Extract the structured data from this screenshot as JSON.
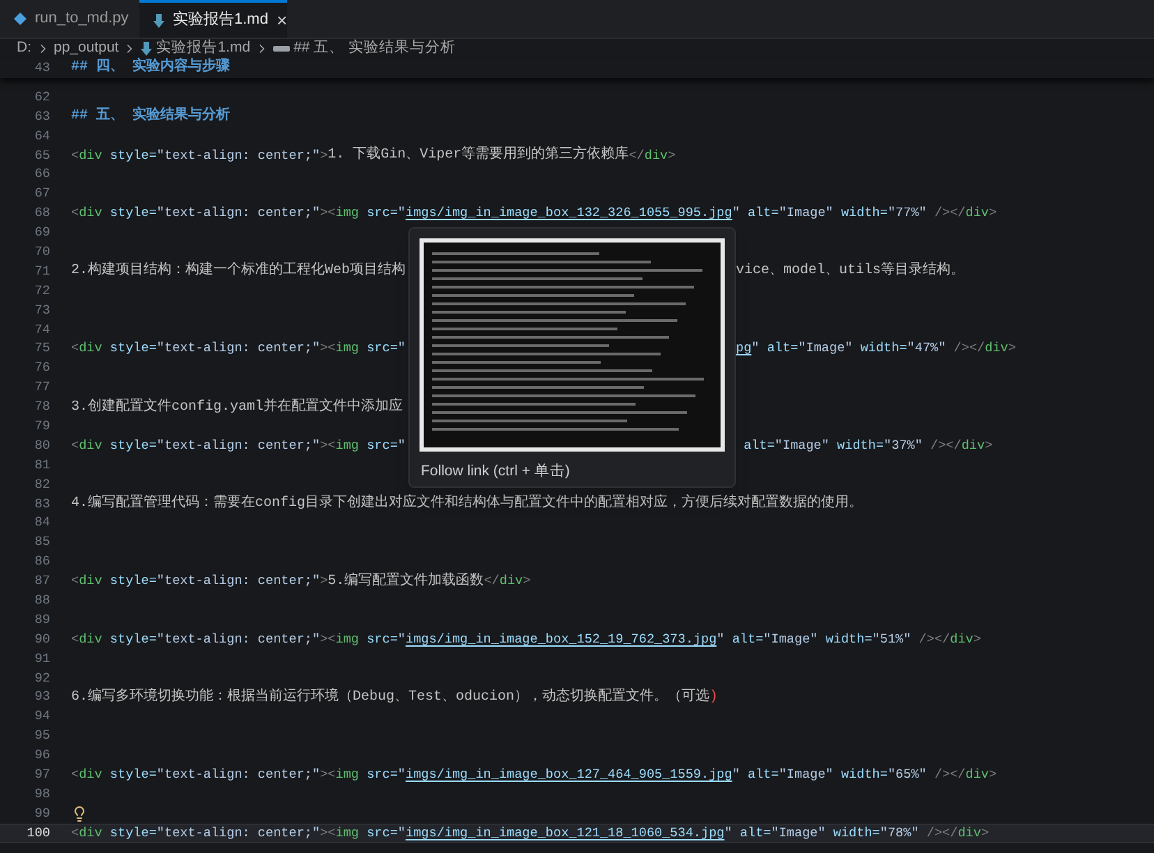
{
  "tabs": [
    {
      "label": "run_to_md.py",
      "kind": "python",
      "selected": false
    },
    {
      "label": "实验报告1.md",
      "kind": "markdown",
      "selected": true
    }
  ],
  "close_glyph": "×",
  "breadcrumb": [
    {
      "label": "D:",
      "kind": "folder"
    },
    {
      "label": "pp_output",
      "kind": "folder"
    },
    {
      "label": "实验报告1.md",
      "kind": "markdown"
    },
    {
      "label": "## 五、 实验结果与分析",
      "kind": "symbol"
    }
  ],
  "sticky_line": {
    "number": "43",
    "tokens": [
      {
        "kind": "heading",
        "text": "## 四、 实验内容与步骤"
      }
    ]
  },
  "lines": [
    {
      "number": "62",
      "current": false,
      "lightbulb": false
    },
    {
      "number": "63",
      "current": false,
      "lightbulb": false,
      "tokens": [
        {
          "kind": "heading",
          "text": "## 五、 实验结果与分析"
        }
      ]
    },
    {
      "number": "64",
      "current": false,
      "lightbulb": false
    },
    {
      "number": "65",
      "current": false,
      "lightbulb": false,
      "tokens": [
        {
          "kind": "punct",
          "text": "<"
        },
        {
          "kind": "tag",
          "text": "div"
        },
        {
          "kind": "attr",
          "text": " style="
        },
        {
          "kind": "str",
          "text": "\"text-align: center;\""
        },
        {
          "kind": "punct",
          "text": ">"
        },
        {
          "kind": "text",
          "text": "1. 下载Gin、Viper等需要用到的第三方依赖库"
        },
        {
          "kind": "punct",
          "text": "</"
        },
        {
          "kind": "tag",
          "text": "div"
        },
        {
          "kind": "punct",
          "text": ">"
        }
      ]
    },
    {
      "number": "66",
      "current": false,
      "lightbulb": false
    },
    {
      "number": "67",
      "current": false,
      "lightbulb": false
    },
    {
      "number": "68",
      "current": false,
      "lightbulb": false,
      "tokens": [
        {
          "kind": "punct",
          "text": "<"
        },
        {
          "kind": "tag",
          "text": "div"
        },
        {
          "kind": "attr",
          "text": " style="
        },
        {
          "kind": "str",
          "text": "\"text-align: center;\""
        },
        {
          "kind": "punct",
          "text": "><"
        },
        {
          "kind": "tag",
          "text": "img"
        },
        {
          "kind": "attr",
          "text": " src="
        },
        {
          "kind": "str",
          "text": "\""
        },
        {
          "kind": "link",
          "text": "imgs/img_in_image_box_132_326_1055_995.jpg"
        },
        {
          "kind": "str",
          "text": "\""
        },
        {
          "kind": "attr",
          "text": " alt="
        },
        {
          "kind": "str",
          "text": "\"Image\""
        },
        {
          "kind": "attr",
          "text": " width="
        },
        {
          "kind": "str",
          "text": "\"77%\""
        },
        {
          "kind": "punct",
          "text": " /></"
        },
        {
          "kind": "tag",
          "text": "div"
        },
        {
          "kind": "punct",
          "text": ">"
        }
      ]
    },
    {
      "number": "69",
      "current": false,
      "lightbulb": false
    },
    {
      "number": "70",
      "current": false,
      "lightbulb": false
    },
    {
      "number": "71",
      "current": false,
      "lightbulb": false,
      "tokens": [
        {
          "kind": "text",
          "text": "2.构建项目结构：构建一个标准的工程化Web项目结构"
        }
      ],
      "tokens_after": [
        {
          "kind": "text",
          "text": "vice、model、utils等目录结构。"
        }
      ]
    },
    {
      "number": "72",
      "current": false,
      "lightbulb": false
    },
    {
      "number": "73",
      "current": false,
      "lightbulb": false
    },
    {
      "number": "74",
      "current": false,
      "lightbulb": false
    },
    {
      "number": "75",
      "current": false,
      "lightbulb": false,
      "tokens": [
        {
          "kind": "punct",
          "text": "<"
        },
        {
          "kind": "tag",
          "text": "div"
        },
        {
          "kind": "attr",
          "text": " style="
        },
        {
          "kind": "str",
          "text": "\"text-align: center;\""
        },
        {
          "kind": "punct",
          "text": "><"
        },
        {
          "kind": "tag",
          "text": "img"
        },
        {
          "kind": "attr",
          "text": " src="
        },
        {
          "kind": "str",
          "text": "\""
        }
      ],
      "tokens_after": [
        {
          "kind": "link",
          "text": "pg"
        },
        {
          "kind": "str",
          "text": "\""
        },
        {
          "kind": "attr",
          "text": " alt="
        },
        {
          "kind": "str",
          "text": "\"Image\""
        },
        {
          "kind": "attr",
          "text": " width="
        },
        {
          "kind": "str",
          "text": "\"47%\""
        },
        {
          "kind": "punct",
          "text": " /></"
        },
        {
          "kind": "tag",
          "text": "div"
        },
        {
          "kind": "punct",
          "text": ">"
        }
      ]
    },
    {
      "number": "76",
      "current": false,
      "lightbulb": false
    },
    {
      "number": "77",
      "current": false,
      "lightbulb": false
    },
    {
      "number": "78",
      "current": false,
      "lightbulb": false,
      "tokens": [
        {
          "kind": "text",
          "text": "3.创建配置文件config.yaml并在配置文件中添加应"
        }
      ]
    },
    {
      "number": "79",
      "current": false,
      "lightbulb": false
    },
    {
      "number": "80",
      "current": false,
      "lightbulb": false,
      "tokens": [
        {
          "kind": "punct",
          "text": "<"
        },
        {
          "kind": "tag",
          "text": "div"
        },
        {
          "kind": "attr",
          "text": " style="
        },
        {
          "kind": "str",
          "text": "\"text-align: center;\""
        },
        {
          "kind": "punct",
          "text": "><"
        },
        {
          "kind": "tag",
          "text": "img"
        },
        {
          "kind": "attr",
          "text": " src="
        },
        {
          "kind": "str",
          "text": "\""
        }
      ],
      "tokens_after": [
        {
          "kind": "attr",
          "text": " alt="
        },
        {
          "kind": "str",
          "text": "\"Image\""
        },
        {
          "kind": "attr",
          "text": " width="
        },
        {
          "kind": "str",
          "text": "\"37%\""
        },
        {
          "kind": "punct",
          "text": " /></"
        },
        {
          "kind": "tag",
          "text": "div"
        },
        {
          "kind": "punct",
          "text": ">"
        }
      ]
    },
    {
      "number": "81",
      "current": false,
      "lightbulb": false
    },
    {
      "number": "82",
      "current": false,
      "lightbulb": false
    },
    {
      "number": "83",
      "current": false,
      "lightbulb": false,
      "tokens": [
        {
          "kind": "text",
          "text": "4.编写配置管理代码：需要在config目录下创建出对应文件和结构体与配置文件中的配置相对应，方便后续对配置数据的使用。"
        }
      ]
    },
    {
      "number": "84",
      "current": false,
      "lightbulb": false
    },
    {
      "number": "85",
      "current": false,
      "lightbulb": false
    },
    {
      "number": "86",
      "current": false,
      "lightbulb": false
    },
    {
      "number": "87",
      "current": false,
      "lightbulb": false,
      "tokens": [
        {
          "kind": "punct",
          "text": "<"
        },
        {
          "kind": "tag",
          "text": "div"
        },
        {
          "kind": "attr",
          "text": " style="
        },
        {
          "kind": "str",
          "text": "\"text-align: center;\""
        },
        {
          "kind": "punct",
          "text": ">"
        },
        {
          "kind": "text",
          "text": "5.编写配置文件加载函数"
        },
        {
          "kind": "punct",
          "text": "</"
        },
        {
          "kind": "tag",
          "text": "div"
        },
        {
          "kind": "punct",
          "text": ">"
        }
      ]
    },
    {
      "number": "88",
      "current": false,
      "lightbulb": false
    },
    {
      "number": "89",
      "current": false,
      "lightbulb": false
    },
    {
      "number": "90",
      "current": false,
      "lightbulb": false,
      "tokens": [
        {
          "kind": "punct",
          "text": "<"
        },
        {
          "kind": "tag",
          "text": "div"
        },
        {
          "kind": "attr",
          "text": " style="
        },
        {
          "kind": "str",
          "text": "\"text-align: center;\""
        },
        {
          "kind": "punct",
          "text": "><"
        },
        {
          "kind": "tag",
          "text": "img"
        },
        {
          "kind": "attr",
          "text": " src="
        },
        {
          "kind": "str",
          "text": "\""
        },
        {
          "kind": "link",
          "text": "imgs/img_in_image_box_152_19_762_373.jpg"
        },
        {
          "kind": "str",
          "text": "\""
        },
        {
          "kind": "attr",
          "text": " alt="
        },
        {
          "kind": "str",
          "text": "\"Image\""
        },
        {
          "kind": "attr",
          "text": " width="
        },
        {
          "kind": "str",
          "text": "\"51%\""
        },
        {
          "kind": "punct",
          "text": " /></"
        },
        {
          "kind": "tag",
          "text": "div"
        },
        {
          "kind": "punct",
          "text": ">"
        }
      ]
    },
    {
      "number": "91",
      "current": false,
      "lightbulb": false
    },
    {
      "number": "92",
      "current": false,
      "lightbulb": false
    },
    {
      "number": "93",
      "current": false,
      "lightbulb": false,
      "tokens": [
        {
          "kind": "text",
          "text": "6.编写多环境切换功能：根据当前运行环境（Debug、Test、oducion），动态切换配置文件。（可选"
        },
        {
          "kind": "error",
          "text": ")"
        }
      ]
    },
    {
      "number": "94",
      "current": false,
      "lightbulb": false
    },
    {
      "number": "95",
      "current": false,
      "lightbulb": false
    },
    {
      "number": "96",
      "current": false,
      "lightbulb": false
    },
    {
      "number": "97",
      "current": false,
      "lightbulb": false,
      "tokens": [
        {
          "kind": "punct",
          "text": "<"
        },
        {
          "kind": "tag",
          "text": "div"
        },
        {
          "kind": "attr",
          "text": " style="
        },
        {
          "kind": "str",
          "text": "\"text-align: center;\""
        },
        {
          "kind": "punct",
          "text": "><"
        },
        {
          "kind": "tag",
          "text": "img"
        },
        {
          "kind": "attr",
          "text": " src="
        },
        {
          "kind": "str",
          "text": "\""
        },
        {
          "kind": "link",
          "text": "imgs/img_in_image_box_127_464_905_1559.jpg"
        },
        {
          "kind": "str",
          "text": "\""
        },
        {
          "kind": "attr",
          "text": " alt="
        },
        {
          "kind": "str",
          "text": "\"Image\""
        },
        {
          "kind": "attr",
          "text": " width="
        },
        {
          "kind": "str",
          "text": "\"65%\""
        },
        {
          "kind": "punct",
          "text": " /></"
        },
        {
          "kind": "tag",
          "text": "div"
        },
        {
          "kind": "punct",
          "text": ">"
        }
      ]
    },
    {
      "number": "98",
      "current": false,
      "lightbulb": false
    },
    {
      "number": "99",
      "current": false,
      "lightbulb": true
    },
    {
      "number": "100",
      "current": true,
      "lightbulb": false,
      "tokens": [
        {
          "kind": "punct",
          "text": "<"
        },
        {
          "kind": "tag",
          "text": "div"
        },
        {
          "kind": "attr",
          "text": " style="
        },
        {
          "kind": "str",
          "text": "\"text-align: center;\""
        },
        {
          "kind": "punct",
          "text": "><"
        },
        {
          "kind": "tag",
          "text": "img"
        },
        {
          "kind": "attr",
          "text": " src="
        },
        {
          "kind": "str",
          "text": "\""
        },
        {
          "kind": "link",
          "text": "imgs/img_in_image_box_121_18_1060_534.jpg"
        },
        {
          "kind": "str",
          "text": "\""
        },
        {
          "kind": "attr",
          "text": " alt="
        },
        {
          "kind": "str",
          "text": "\"Image\""
        },
        {
          "kind": "attr",
          "text": " width="
        },
        {
          "kind": "str",
          "text": "\"78%\""
        },
        {
          "kind": "punct",
          "text": " /></"
        },
        {
          "kind": "tag",
          "text": "div"
        },
        {
          "kind": "punct",
          "text": ">"
        }
      ]
    }
  ],
  "hover": {
    "action": "Follow link (ctrl + 单击)"
  }
}
